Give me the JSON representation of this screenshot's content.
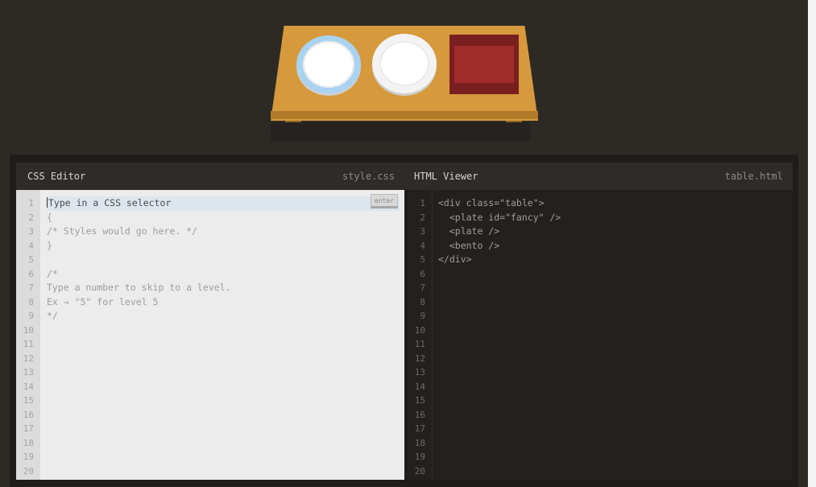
{
  "css_editor": {
    "title": "CSS Editor",
    "filename": "style.css",
    "placeholder": "Type in a CSS selector",
    "enter_label": "enter",
    "lines": [
      "{",
      "/* Styles would go here. */",
      "}",
      "",
      "/*",
      "Type a number to skip to a level.",
      "Ex → \"5\" for level 5",
      "*/"
    ],
    "line_numbers": [
      "1",
      "2",
      "3",
      "4",
      "5",
      "6",
      "7",
      "8",
      "9",
      "10",
      "11",
      "12",
      "13",
      "14",
      "15",
      "16",
      "17",
      "18",
      "19",
      "20"
    ]
  },
  "html_viewer": {
    "title": "HTML Viewer",
    "filename": "table.html",
    "lines": [
      "<div class=\"table\">",
      "  <plate id=\"fancy\" />",
      "  <plate />",
      "  <bento />",
      "</div>"
    ],
    "line_numbers": [
      "1",
      "2",
      "3",
      "4",
      "5",
      "6",
      "7",
      "8",
      "9",
      "10",
      "11",
      "12",
      "13",
      "14",
      "15",
      "16",
      "17",
      "18",
      "19",
      "20"
    ]
  },
  "scene": {
    "items": [
      "fancy-plate",
      "plate",
      "bento"
    ]
  },
  "colors": {
    "background": "#2d2a26",
    "table": "#d6993c",
    "plate_fancy_rim": "#a9d3f0",
    "bento": "#a22c2c"
  }
}
